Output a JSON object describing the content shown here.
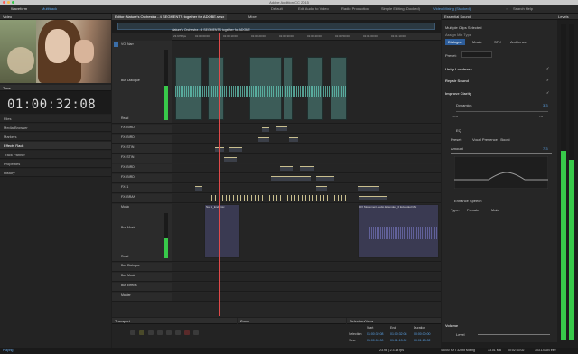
{
  "app_title": "Adobe Audition CC 2015",
  "toolbar": {
    "waveform": "Waveform",
    "multitrack": "Multitrack",
    "workspaces": [
      "Default",
      "Edit Audio to Video",
      "Radio Production",
      "Simple Editing (Docked)",
      "Video Mixing (Stacked)"
    ],
    "search": "Search Help"
  },
  "video_panel": {
    "title": "Video"
  },
  "time_panel": {
    "title": "Time",
    "timecode": "01:00:32:08"
  },
  "left_nav": [
    "Files",
    "Media Browser",
    "Markers",
    "Effects Rack",
    "Track Panner",
    "Properties",
    "History"
  ],
  "editor": {
    "tab_title": "Editor: Nature's Orchestra - 4 SEGMENTS together for ADOBE.sesx",
    "mixer_tab": "Mixer",
    "session_label": "Nature's Orchestra - 4 SEGMENTS together for ADOBE",
    "ruler_ticks": [
      "23.976 fps",
      "01:00:00:00",
      "01:00:10:00",
      "01:00:20:00",
      "01:00:30:00",
      "01:00:40:00",
      "01:00:50:00",
      "01:01:00:00",
      "01:01:10:00"
    ]
  },
  "tracks": [
    {
      "name": "VO: Narr",
      "sub": "Bus Dialogue",
      "read": "Read"
    },
    {
      "name": "FX: BIRD"
    },
    {
      "name": "FX: BIRD"
    },
    {
      "name": "FX: STIN"
    },
    {
      "name": "FX: STIN"
    },
    {
      "name": "FX: BIRD"
    },
    {
      "name": "FX: BIRD"
    },
    {
      "name": "FX: 1"
    },
    {
      "name": "FX: BRAN"
    },
    {
      "name": "Music",
      "sub": "Bus Music",
      "read": "Read"
    },
    {
      "name": "Bus Dialogue"
    },
    {
      "name": "Bus Music"
    },
    {
      "name": "Bus Effects"
    },
    {
      "name": "Master"
    }
  ],
  "clip_labels": {
    "music_a": "Nat 1_End_mix",
    "music_b": "DX Movement Audio Extended_0 Extended Mix"
  },
  "essential_sound": {
    "title": "Essential Sound",
    "levels_tab": "Levels",
    "clips_selected": "Multiple Clips Selected",
    "assign": "Assign Mix Type",
    "types": [
      "Dialogue",
      "Music",
      "SFX",
      "Ambience"
    ],
    "preset_label": "Preset:",
    "sections": [
      "Unify Loudness",
      "Repair Sound",
      "Improve Clarity",
      "Dynamics",
      "EQ",
      "Enhance Speech"
    ],
    "dynamics_value": "3.3",
    "eq_preset_label": "Preset:",
    "eq_preset_value": "Vocal Presence - Boost",
    "amount_label": "Amount",
    "amount_value": "7.3",
    "near": "Near",
    "far": "Far",
    "type_label": "Type:",
    "female": "Female",
    "male": "Male",
    "volume_label": "Volume",
    "level_label": "Level"
  },
  "transport": {
    "title": "Transport"
  },
  "zoom": {
    "title": "Zoom"
  },
  "selection_view": {
    "title": "Selection/View",
    "headers": [
      "Start",
      "End",
      "Duration"
    ],
    "rows": [
      {
        "label": "Selection",
        "start": "01:00:32:08",
        "end": "01:00:32:08",
        "duration": "00:00:00:00"
      },
      {
        "label": "View",
        "start": "01:00:00:00",
        "end": "01:01:13:02",
        "duration": "00:01:13:02"
      }
    ]
  },
  "status": {
    "left": "Playing",
    "right": [
      "23.98 | 2.3.38 fps",
      "48000 Hz • 32-bit Mixing",
      "33.01 MB",
      "00:02:53:02",
      "303.14 GB free"
    ]
  },
  "colors": {
    "accent": "#5aa2e6",
    "waveform": "#3c9c8a",
    "meter": "#38c94a",
    "playhead": "#e04a4a"
  }
}
